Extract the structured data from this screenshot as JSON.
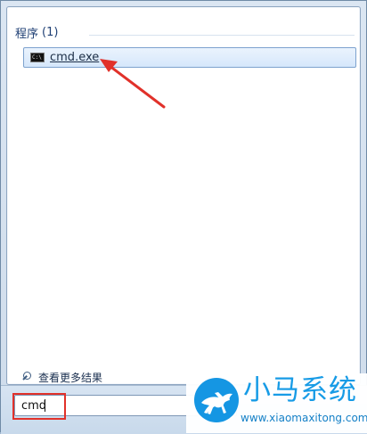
{
  "start_menu": {
    "section_title": "程序",
    "section_count": "(1)",
    "result": {
      "label": "cmd.exe",
      "icon": "command-prompt-icon",
      "icon_text": "C:\\"
    },
    "more_results": "查看更多结果",
    "search": {
      "value": "cmd"
    }
  },
  "watermark": {
    "brand_name": "小马系统",
    "url": "www.xiaomaxitong.com",
    "logo_icon": "horse-logo"
  },
  "annotations": {
    "accent_color": "#e1312a"
  }
}
